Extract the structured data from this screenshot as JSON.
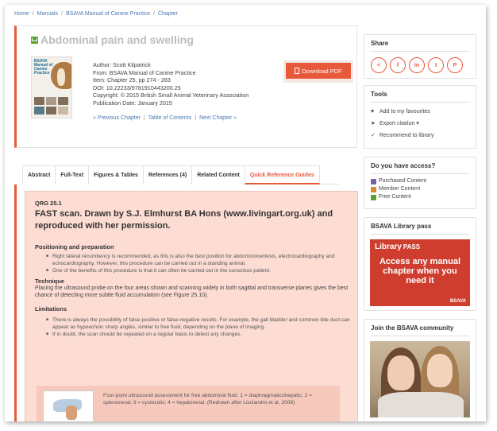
{
  "breadcrumb": {
    "items": [
      "Home",
      "Manuals",
      "BSAVA Manual of Canine Practice",
      "Chapter"
    ],
    "separator": "/"
  },
  "chapter": {
    "title": "Abdominal pain and swelling",
    "meta": {
      "author": "Author: Scott Kilpatrick",
      "from": "From: BSAVA Manual of Canine Practice",
      "item": "Item: Chapter 25, pp 274 - 283",
      "doi": "DOI: 10.22233/9781910443200.25",
      "copyright": "Copyright: © 2015 British Small Animal Veterinary Association",
      "pubdate": "Publication Date: January 2015"
    },
    "cover": {
      "title": "BSAVA Manual of Canine Practice"
    },
    "download_label": "Download PDF",
    "nav": {
      "prev": "« Previous Chapter",
      "toc": "Table of Contents",
      "next": "Next Chapter »"
    }
  },
  "tabs": [
    {
      "label": "Abstract"
    },
    {
      "label": "Full-Text"
    },
    {
      "label": "Figures & Tables"
    },
    {
      "label": "References (4)"
    },
    {
      "label": "Related Content"
    },
    {
      "label": "Quick Reference Guides",
      "active": true
    }
  ],
  "qrg": {
    "code": "QRG 25.1",
    "title": "FAST scan. Drawn by S.J. Elmhurst BA Hons (www.livingart.org.uk) and reproduced with her permission.",
    "positioning": {
      "heading": "Positioning and preparation",
      "bullets": [
        "Right lateral recumbency is recommended, as this is also the best position for abdominocentesis, electrocardiography and echocardiography. However, this procedure can be carried out in a standing animal.",
        "One of the benefits of this procedure is that it can often be carried out in the conscious patient."
      ]
    },
    "technique": {
      "heading": "Technique",
      "text": "Placing the ultrasound probe on the four areas shown and scanning widely in both sagittal and transverse planes gives the best chance of detecting more subtle fluid accumulation (see Figure 25.10)."
    },
    "limitations": {
      "heading": "Limitations",
      "bullets": [
        "There is always the possibility of false-positive or false-negative results. For example, the gall bladder and common bile duct can appear as hypoechoic sharp angles, similar to free fluid, depending on the plane of imaging.",
        "If in doubt, the scan should be repeated on a regular basis to detect any changes."
      ]
    },
    "figure_caption": "Four-point ultrasound assessment for free abdominal fluid. 1 = diaphragmaticohepatic; 2 = splenorenal; 3 = cystocolic; 4 = hepatorenal. (Redrawn after Lisciandro et al, 2009)"
  },
  "sidebar": {
    "share": {
      "heading": "Share",
      "icons": [
        "share-icon",
        "facebook-icon",
        "linkedin-icon",
        "twitter-icon",
        "print-icon"
      ],
      "glyphs": [
        "<",
        "f",
        "in",
        "t",
        "P"
      ]
    },
    "tools": {
      "heading": "Tools",
      "items": [
        "Add to my favourites",
        "Export citation ▾",
        "Recommend to library"
      ],
      "icons": [
        "heart-icon",
        "send-icon",
        "thumbs-up-icon"
      ],
      "glyphs": [
        "♥",
        "➤",
        "✓"
      ]
    },
    "access": {
      "heading": "Do you have access?",
      "items": [
        "Purchased Content",
        "Member Content",
        "Free Content"
      ],
      "colors": [
        "#7a5fa8",
        "#d68a2b",
        "#5aa034"
      ]
    },
    "pass": {
      "heading": "BSAVA Library pass",
      "promo_logo": "Library",
      "promo_logo_suffix": "PASS",
      "promo_text": "Access any manual chapter when you need it",
      "promo_brand": "BSAVA"
    },
    "community": {
      "heading": "Join the BSAVA community"
    }
  },
  "colors": {
    "accent": "#e8593c",
    "link": "#4a7ab0",
    "qrg_bg": "#fcdcd3",
    "free_badge": "#5aa034"
  }
}
